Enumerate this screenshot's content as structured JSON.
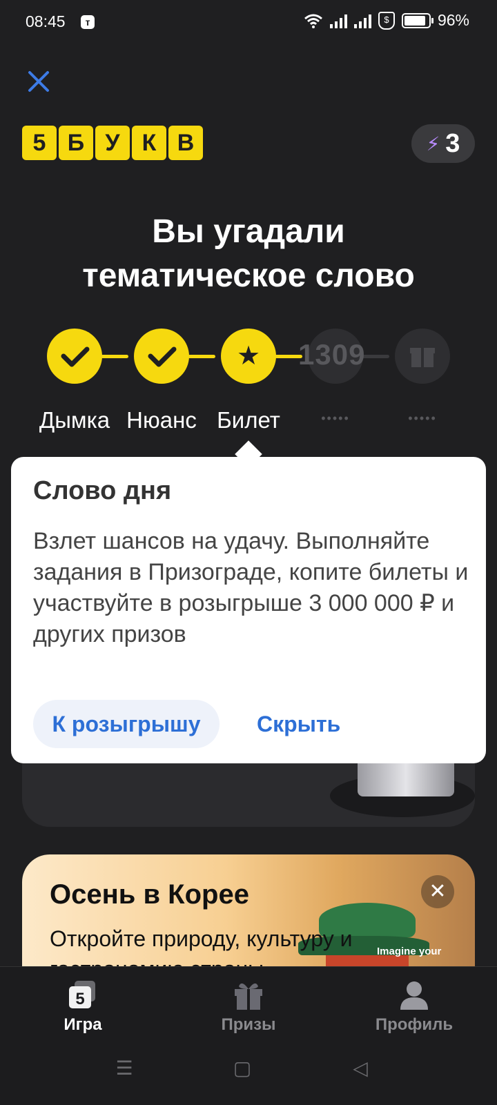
{
  "status_bar": {
    "time": "08:45",
    "battery": "96%"
  },
  "header": {
    "logo_letters": [
      "5",
      "Б",
      "У",
      "К",
      "В"
    ],
    "energy_count": "3"
  },
  "headline": {
    "line1": "Вы угадали",
    "line2": "тематическое слово"
  },
  "progress": {
    "counter": "1309",
    "words": [
      "Дымка",
      "Нюанс",
      "Билет"
    ],
    "hidden_placeholder": "•••••"
  },
  "popover": {
    "title": "Слово дня",
    "body": "Взлет шансов на удачу. Выполняйте задания в Призограде, копите билеты и участвуйте в розыгрыше 3 000 000 ₽ и других призов",
    "primary_button": "К розыгрышу",
    "secondary_button": "Скрыть"
  },
  "promo": {
    "title": "Осень в Корее",
    "subtitle": "Откройте природу, культуру и гастрономию страны",
    "image_text": "Imagine your"
  },
  "bottom_nav": {
    "items": [
      {
        "label": "Игра",
        "icon": "game-icon",
        "active": true
      },
      {
        "label": "Призы",
        "icon": "gift-icon",
        "active": false
      },
      {
        "label": "Профиль",
        "icon": "profile-icon",
        "active": false
      }
    ]
  },
  "colors": {
    "accent_yellow": "#f6d90f",
    "link_blue": "#2d6fd6",
    "background": "#1f1f21"
  }
}
